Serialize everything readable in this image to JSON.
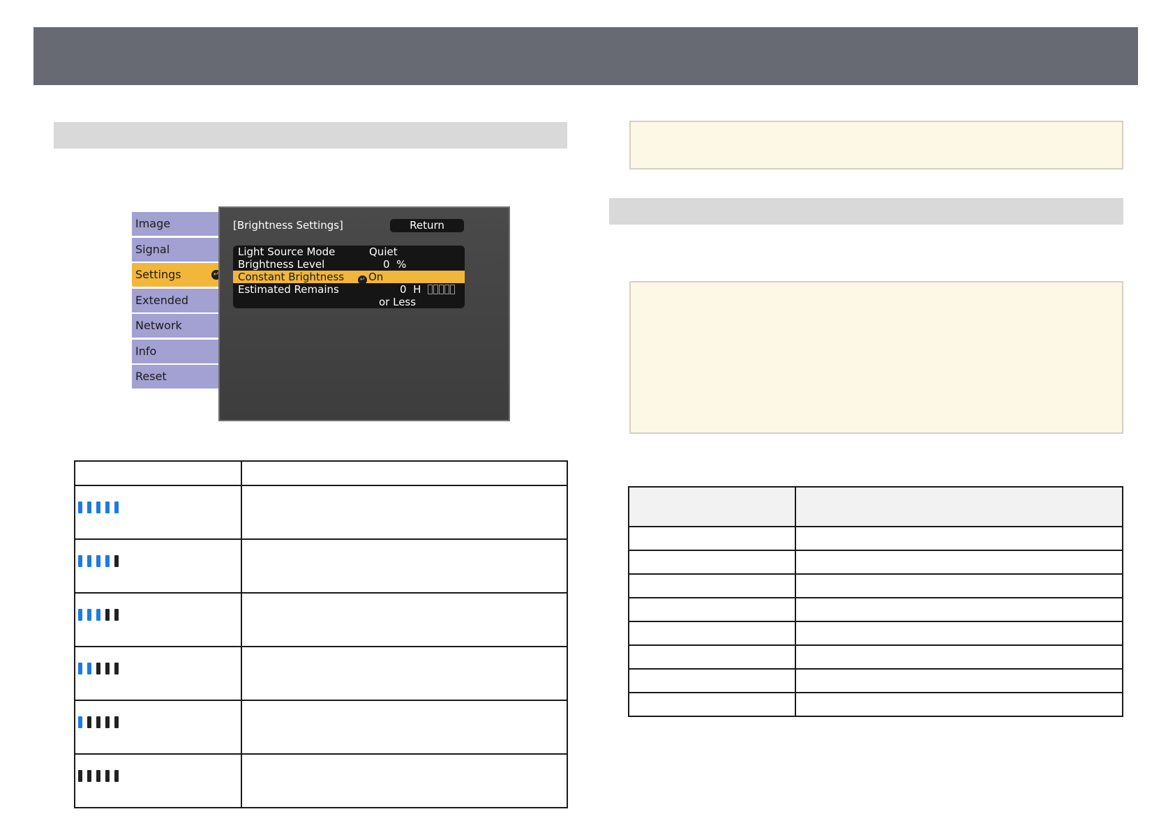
{
  "osd": {
    "tabs": [
      "Image",
      "Signal",
      "Settings",
      "Extended",
      "Network",
      "Info",
      "Reset"
    ],
    "active_tab": "Settings",
    "panel_title": "[Brightness Settings]",
    "return_label": "Return",
    "rows": [
      {
        "label": "Light Source Mode",
        "value": "Quiet"
      },
      {
        "label": "Brightness Level",
        "value": "0  %"
      },
      {
        "label": "Constant Brightness",
        "value": "On"
      },
      {
        "label": "Estimated Remains",
        "value": "0  H",
        "value2": "or Less"
      }
    ]
  },
  "indicator_table": {
    "rows": [
      {
        "level": 5
      },
      {
        "level": 4
      },
      {
        "level": 3
      },
      {
        "level": 2
      },
      {
        "level": 1
      },
      {
        "level": 0
      }
    ]
  },
  "colors": {
    "header_bar": "#676a73",
    "note_background": "#fdf8e6",
    "indicator_on": "#1b7be4",
    "indicator_off": "#222222",
    "osd_highlight": "#f2b63b",
    "osd_tab": "#a3a0d2"
  }
}
